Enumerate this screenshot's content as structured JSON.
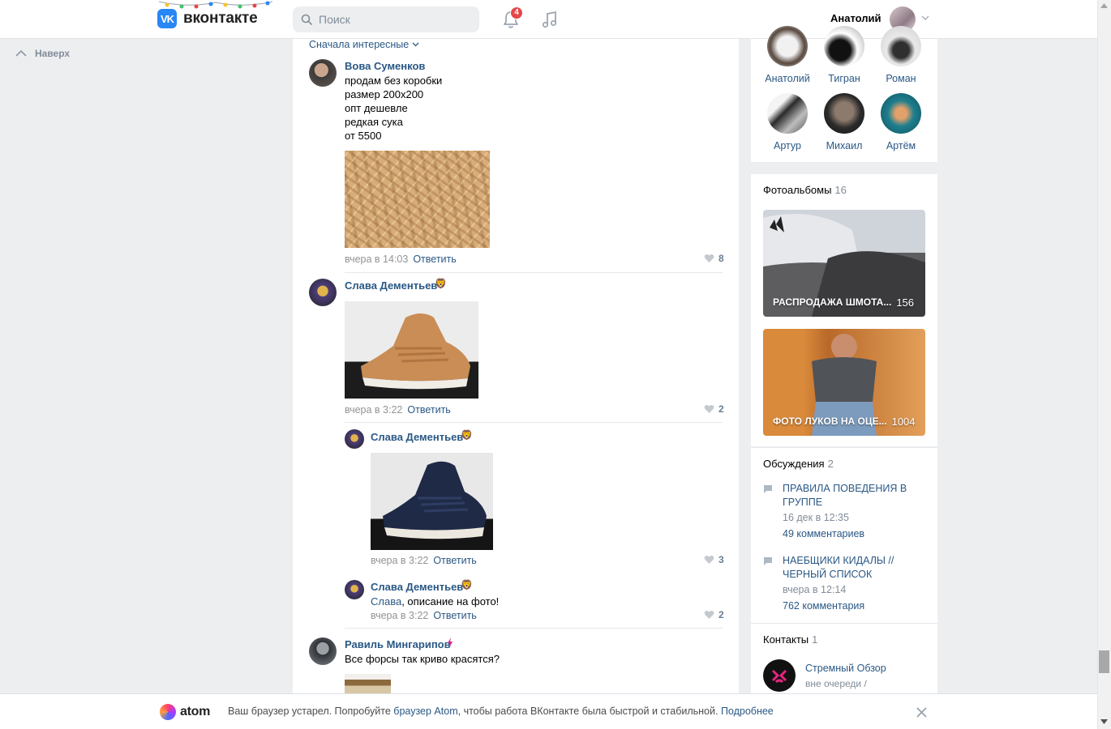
{
  "header": {
    "logo_text": "вконтакте",
    "logo_mark": "VK",
    "search_placeholder": "Поиск",
    "notifications_count": "4",
    "user_name": "Анатолий"
  },
  "left": {
    "up_label": "Наверх"
  },
  "comments": {
    "sort_label": "Сначала интересные",
    "items": [
      {
        "author": "Вова Суменков",
        "lines": [
          "продам без коробки",
          "размер 200x200",
          "опт дешевле",
          "редкая сука",
          "от 5500"
        ],
        "time": "вчера в 14:03",
        "reply": "Ответить",
        "likes": "8"
      },
      {
        "author": "Слава Дементьев",
        "time": "вчера в 3:22",
        "reply": "Ответить",
        "likes": "2"
      },
      {
        "author": "Слава Дементьев",
        "time": "вчера в 3:22",
        "reply": "Ответить",
        "likes": "3"
      },
      {
        "author": "Слава Дементьев",
        "mention": "Слава",
        "text": ", описание на фото!",
        "time": "вчера в 3:22",
        "reply": "Ответить",
        "likes": "2"
      },
      {
        "author": "Равиль Мингарипов",
        "text": "Все форсы так криво красятся?"
      }
    ]
  },
  "friends": [
    "Анатолий",
    "Тигран",
    "Роман",
    "Артур",
    "Михаил",
    "Артём"
  ],
  "albums": {
    "title": "Фотоальбомы",
    "count": "16",
    "items": [
      {
        "title": "РАСПРОДАЖА ШМОТА...",
        "count": "156"
      },
      {
        "title": "ФОТО ЛУКОВ НА ОЦЕ...",
        "count": "1004"
      }
    ]
  },
  "discussions": {
    "title": "Обсуждения",
    "count": "2",
    "items": [
      {
        "title": "ПРАВИЛА ПОВЕДЕНИЯ В ГРУППЕ",
        "date": "16 дек в 12:35",
        "comments": "49 комментариев"
      },
      {
        "title": "НАЕБЩИКИ КИДАЛЫ // ЧЕРНЫЙ СПИСОК",
        "date": "вчера в 12:14",
        "comments": "762 комментария"
      }
    ]
  },
  "contacts": {
    "title": "Контакты",
    "count": "1",
    "items": [
      {
        "name": "Стремный Обзор",
        "role": "вне очереди /"
      }
    ]
  },
  "atom_banner": {
    "logo_text": "atom",
    "text_before": "Ваш браузер устарел. Попробуйте ",
    "link": "браузер Atom",
    "text_after": ", чтобы работа ВКонтакте была быстрой и стабильной. ",
    "more": "Подробнее"
  }
}
